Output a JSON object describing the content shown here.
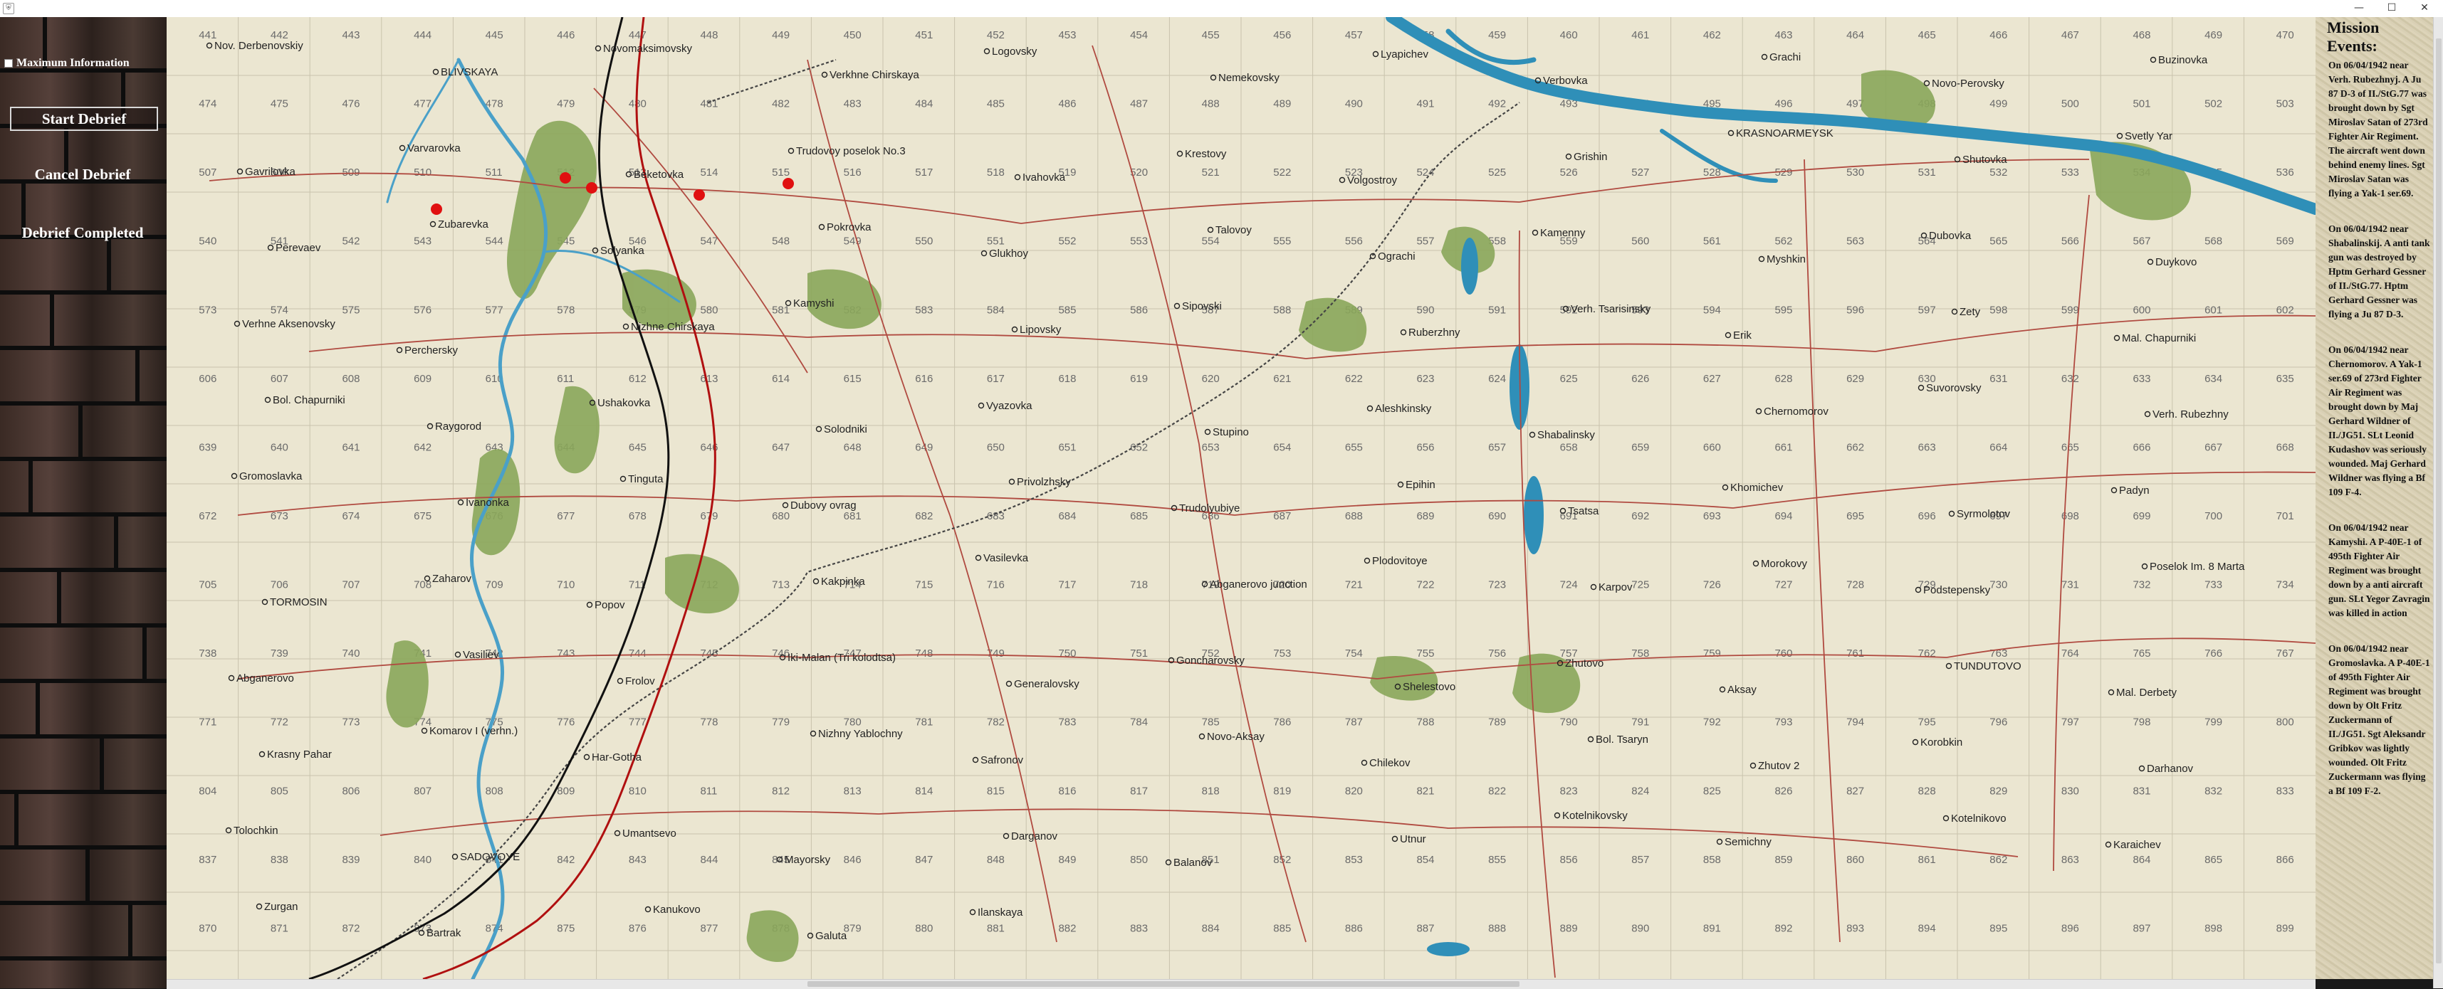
{
  "window": {
    "minimize": "—",
    "maximize": "☐",
    "close": "✕",
    "app_icon": "⛨"
  },
  "sidebar": {
    "max_info_label": "Maximum Information",
    "start_debrief": "Start Debrief",
    "cancel_debrief": "Cancel Debrief",
    "debrief_completed": "Debrief Completed"
  },
  "events": {
    "title": "Mission Events:",
    "items": [
      "On 06/04/1942 near Verh. Rubezhnyj. A Ju 87 D-3 of II./StG.77 was brought down by Sgt Miroslav Satan of 273rd Fighter Air Regiment. The aircraft went down behind enemy lines. Sgt Miroslav Satan was flying a Yak-1 ser.69.",
      "On 06/04/1942 near Shabalinskij. A anti tank gun was destroyed by Hptm Gerhard Gessner of II./StG.77. Hptm Gerhard Gessner was flying a Ju 87 D-3.",
      "On 06/04/1942 near Chernomorov. A Yak-1 ser.69 of 273rd Fighter Air Regiment was brought down by Maj Gerhard Wildner of II./JG51. SLt Leonid Kudashov was seriously wounded. Maj Gerhard Wildner was flying a Bf 109 F-4.",
      "On 06/04/1942 near Kamyshi. A P-40E-1 of 495th Fighter Air Regiment was brought down by a anti aircraft gun. SLt Yegor Zavragin was killed in action",
      "On 06/04/1942 near Gromoslavka. A P-40E-1 of 495th Fighter Air Regiment was brought down by Olt Fritz Zuckermann of II./JG51. Sgt Aleksandr Gribkov was lightly wounded. Olt Fritz Zuckermann was flying a Bf 109 F-2."
    ]
  },
  "map": {
    "towns": [
      {
        "n": "Nov. Derbenovskiy"
      },
      {
        "n": "BLIVSKAYA"
      },
      {
        "n": "Novomaksimovsky"
      },
      {
        "n": "Verkhne Chirskaya"
      },
      {
        "n": "Logovsky"
      },
      {
        "n": "Nemekovsky"
      },
      {
        "n": "Lyapichev"
      },
      {
        "n": "Verbovka"
      },
      {
        "n": "Grachi"
      },
      {
        "n": "Novo-Perovsky"
      },
      {
        "n": "Buzinovka"
      },
      {
        "n": "Gavrilovka"
      },
      {
        "n": "Varvarovka"
      },
      {
        "n": "Beketovka"
      },
      {
        "n": "Trudovoy poselok No.3"
      },
      {
        "n": "Ivahovka"
      },
      {
        "n": "Krestovy"
      },
      {
        "n": "Volgostroy"
      },
      {
        "n": "Grishin"
      },
      {
        "n": "KRASNOARMEYSK"
      },
      {
        "n": "Shutovka"
      },
      {
        "n": "Svetly Yar"
      },
      {
        "n": "Perevaev"
      },
      {
        "n": "Zubarevka"
      },
      {
        "n": "Solyanka"
      },
      {
        "n": "Pokrovka"
      },
      {
        "n": "Glukhoy"
      },
      {
        "n": "Talovoy"
      },
      {
        "n": "Ograchi"
      },
      {
        "n": "Kamenny"
      },
      {
        "n": "Myshkin"
      },
      {
        "n": "Dubovka"
      },
      {
        "n": "Duykovo"
      },
      {
        "n": "Verhne Aksenovsky"
      },
      {
        "n": "Perchersky"
      },
      {
        "n": "Nizhne Chirskaya"
      },
      {
        "n": "Kamyshi"
      },
      {
        "n": "Lipovsky"
      },
      {
        "n": "Sipovski"
      },
      {
        "n": "Ruberzhny"
      },
      {
        "n": "Verh. Tsarisinsky"
      },
      {
        "n": "Erik"
      },
      {
        "n": "Zety"
      },
      {
        "n": "Mal. Chapurniki"
      },
      {
        "n": "Bol. Chapurniki"
      },
      {
        "n": "Raygorod"
      },
      {
        "n": "Ushakovka"
      },
      {
        "n": "Solodniki"
      },
      {
        "n": "Vyazovka"
      },
      {
        "n": "Stupino"
      },
      {
        "n": "Aleshkinsky"
      },
      {
        "n": "Shabalinsky"
      },
      {
        "n": "Chernomorov"
      },
      {
        "n": "Suvorovsky"
      },
      {
        "n": "Verh. Rubezhny"
      },
      {
        "n": "Gromoslavka"
      },
      {
        "n": "Ivanonka"
      },
      {
        "n": "Tinguta"
      },
      {
        "n": "Dubovy ovrag"
      },
      {
        "n": "Privolzhsky"
      },
      {
        "n": "Trudolyubiye"
      },
      {
        "n": "Epihin"
      },
      {
        "n": "Tsatsa"
      },
      {
        "n": "Khomichev"
      },
      {
        "n": "Syrmolotov"
      },
      {
        "n": "Padyn"
      },
      {
        "n": "TORMOSIN"
      },
      {
        "n": "Zaharov"
      },
      {
        "n": "Popov"
      },
      {
        "n": "Kakpinka"
      },
      {
        "n": "Vasilevka"
      },
      {
        "n": "Abganerovo junction"
      },
      {
        "n": "Plodovitoye"
      },
      {
        "n": "Karpov"
      },
      {
        "n": "Morokovy"
      },
      {
        "n": "Podstepensky"
      },
      {
        "n": "Poselok Im. 8 Marta"
      },
      {
        "n": "Abganerovo"
      },
      {
        "n": "Vasiliev"
      },
      {
        "n": "Frolov"
      },
      {
        "n": "Iki-Malan (Tri kolodtsa)"
      },
      {
        "n": "Generalovsky"
      },
      {
        "n": "Goncharovsky"
      },
      {
        "n": "Shelestovo"
      },
      {
        "n": "Zhutovo"
      },
      {
        "n": "Aksay"
      },
      {
        "n": "TUNDUTOVO"
      },
      {
        "n": "Mal. Derbety"
      },
      {
        "n": "Krasny Pahar"
      },
      {
        "n": "Komarov I (verhn.)"
      },
      {
        "n": "Har-Gotha"
      },
      {
        "n": "Nizhny Yablochny"
      },
      {
        "n": "Safronov"
      },
      {
        "n": "Novo-Aksay"
      },
      {
        "n": "Chilekov"
      },
      {
        "n": "Bol. Tsaryn"
      },
      {
        "n": "Zhutov 2"
      },
      {
        "n": "Korobkin"
      },
      {
        "n": "Darhanov"
      },
      {
        "n": "Tolochkin"
      },
      {
        "n": "SADOVOYE"
      },
      {
        "n": "Umantsevo"
      },
      {
        "n": "Mayorsky"
      },
      {
        "n": "Darganov"
      },
      {
        "n": "Balanov"
      },
      {
        "n": "Utnur"
      },
      {
        "n": "Kotelnikovsky"
      },
      {
        "n": "Semichny"
      },
      {
        "n": "Kotelnikovo"
      },
      {
        "n": "Karaichev"
      },
      {
        "n": "Zurgan"
      },
      {
        "n": "Bartrak"
      },
      {
        "n": "Kanukovo"
      },
      {
        "n": "Galuta"
      },
      {
        "n": "Ilanskaya"
      }
    ],
    "grid_numbers": {
      "first": 441,
      "cols": 30,
      "rows": 14
    },
    "colors": {
      "land": "#ebe6d1",
      "water": "#2f8fb8",
      "forest": "#8aa65a",
      "road": "#b04a40",
      "front_red": "#b01010",
      "front_black": "#111111",
      "rail": "#444444",
      "marker": "#e01010"
    }
  }
}
